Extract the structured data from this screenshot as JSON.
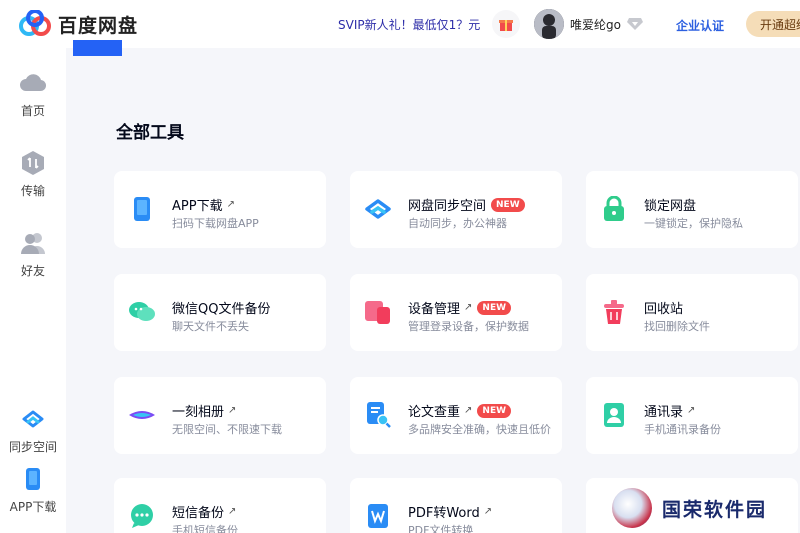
{
  "header": {
    "logo_text": "百度网盘",
    "promo": "SVIP新人礼！最低仅1？元",
    "username": "唯爱纶go",
    "enterprise": "企业认证",
    "open_button": "开通超级会员"
  },
  "sidebar": {
    "items": [
      {
        "label": "首页",
        "icon": "cloud-icon"
      },
      {
        "label": "传输",
        "icon": "transfer-icon"
      },
      {
        "label": "好友",
        "icon": "friends-icon"
      },
      {
        "label": "同步空间",
        "icon": "sync-icon"
      },
      {
        "label": "APP下载",
        "icon": "phone-icon"
      }
    ]
  },
  "main": {
    "title": "全部工具",
    "tools": [
      {
        "title": "APP下载",
        "sub": "扫码下载网盘APP",
        "arrow": true,
        "badge": ""
      },
      {
        "title": "网盘同步空间",
        "sub": "自动同步，办公神器",
        "arrow": false,
        "badge": "NEW"
      },
      {
        "title": "锁定网盘",
        "sub": "一键锁定，保护隐私",
        "arrow": false,
        "badge": ""
      },
      {
        "title": "微信QQ文件备份",
        "sub": "聊天文件不丢失",
        "arrow": false,
        "badge": ""
      },
      {
        "title": "设备管理",
        "sub": "管理登录设备，保护数据",
        "arrow": true,
        "badge": "NEW"
      },
      {
        "title": "回收站",
        "sub": "找回删除文件",
        "arrow": false,
        "badge": ""
      },
      {
        "title": "一刻相册",
        "sub": "无限空间、不限速下载",
        "arrow": true,
        "badge": ""
      },
      {
        "title": "论文查重",
        "sub": "多品牌安全准确，快速且低价",
        "arrow": true,
        "badge": "NEW"
      },
      {
        "title": "通讯录",
        "sub": "手机通讯录备份",
        "arrow": true,
        "badge": ""
      },
      {
        "title": "短信备份",
        "sub": "手机短信备份",
        "arrow": true,
        "badge": ""
      },
      {
        "title": "PDF转Word",
        "sub": "PDF文件转换",
        "arrow": true,
        "badge": ""
      }
    ]
  },
  "watermark": {
    "text": "国荣软件园"
  },
  "colors": {
    "accent": "#2462f5",
    "badge": "#f24b4b",
    "background": "#f5f6fa"
  }
}
